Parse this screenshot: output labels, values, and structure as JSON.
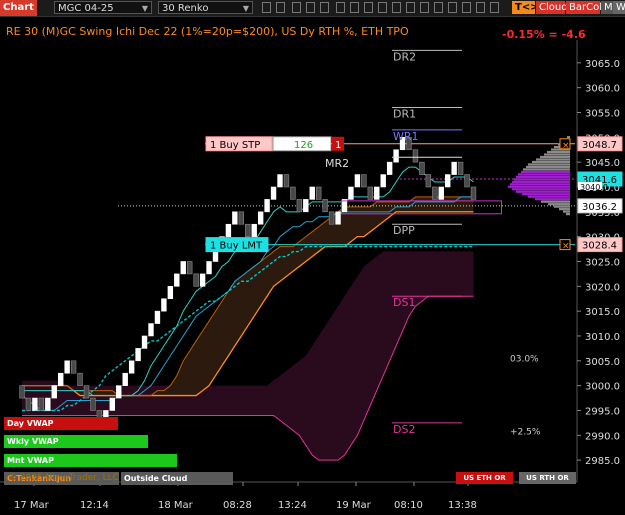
{
  "toolbar": {
    "chart_tab": "Chart",
    "instrument": "MGC 04-25",
    "period_type": "30 Renko",
    "tk_button": "T<>K",
    "cloud_button": "Cloud",
    "barcol_button": "BarCol",
    "m_button": "M",
    "w_button": "W"
  },
  "header": {
    "title": "RE 30 (M)GC Swing Ichi Dec 22 (1%=20p=$200), US Dy RTH %, ETH TPO",
    "change": "-0.15% = -4.6",
    "watermark": "© 2025 NinjaTrader, LLC"
  },
  "colors": {
    "background": "#000000",
    "up_brick": "#ffffff",
    "down_brick": "#000000",
    "axis_text": "#dddddd",
    "accent_orange": "#ff8c1a",
    "cloud_bull": "#2b1a0d",
    "cloud_bear": "#2a0b1e",
    "vwap": "#00c8c8",
    "tpo": "#a020d0"
  },
  "orders": {
    "buy_stop_label": "1 Buy STP",
    "buy_stop_ticks": "126",
    "buy_stop_qty": "1",
    "buy_limit_label": "1 Buy LMT"
  },
  "chart_data": {
    "type": "renko",
    "brick_size": 2.5,
    "y_axis": {
      "min": 2981,
      "max": 3070,
      "ticks": [
        2985.0,
        2990.0,
        2995.0,
        3000.0,
        3005.0,
        3010.0,
        3015.0,
        3020.0,
        3025.0,
        3030.0,
        3035.0,
        3040.0,
        3045.0,
        3050.0,
        3055.0,
        3060.0,
        3065.0
      ]
    },
    "x_axis": {
      "labels": [
        "17 Mar",
        "12:14",
        "18 Mar",
        "08:28",
        "13:24",
        "19 Mar",
        "08:10",
        "13:38"
      ]
    },
    "price_flags": [
      {
        "value": "3048.7",
        "kind": "buy_stop"
      },
      {
        "value": "3041.6",
        "kind": "vwap"
      },
      {
        "value": "3040.0",
        "kind": "last"
      },
      {
        "value": "3036.2",
        "kind": "close"
      },
      {
        "value": "3028.4",
        "kind": "buy_limit"
      }
    ],
    "levels": [
      {
        "name": "DR2",
        "price": 3067.5
      },
      {
        "name": "DR1",
        "price": 3056.0
      },
      {
        "name": "WR1",
        "price": 3051.5
      },
      {
        "name": "MR2",
        "price": 3046.0
      },
      {
        "name": "DPP",
        "price": 3032.5
      },
      {
        "name": "DS1",
        "price": 3018.0
      },
      {
        "name": "DS2",
        "price": 2992.5
      }
    ],
    "annotations": [
      "03.0%",
      "+2.5%"
    ],
    "vwap_legend": [
      "Day VWAP",
      "Wkly VWAP",
      "Mnt VWAP",
      "C:TenkanKijun",
      "Outside Cloud"
    ],
    "footer_tags": [
      "US ETH OR",
      "US RTH OR"
    ],
    "bricks": [
      {
        "o": 3000.0,
        "c": 2997.5
      },
      {
        "o": 2997.5,
        "c": 2995.0
      },
      {
        "o": 2995.0,
        "c": 2997.5
      },
      {
        "o": 2997.5,
        "c": 2995.0
      },
      {
        "o": 2995.0,
        "c": 2997.5
      },
      {
        "o": 2997.5,
        "c": 3000.0
      },
      {
        "o": 3000.0,
        "c": 3002.5
      },
      {
        "o": 3002.5,
        "c": 3005.0
      },
      {
        "o": 3005.0,
        "c": 3002.5
      },
      {
        "o": 3002.5,
        "c": 3000.0
      },
      {
        "o": 3000.0,
        "c": 2997.5
      },
      {
        "o": 2997.5,
        "c": 2995.0
      },
      {
        "o": 2995.0,
        "c": 2992.5
      },
      {
        "o": 2992.5,
        "c": 2995.0
      },
      {
        "o": 2995.0,
        "c": 2997.5
      },
      {
        "o": 2997.5,
        "c": 3000.0
      },
      {
        "o": 3000.0,
        "c": 3002.5
      },
      {
        "o": 3002.5,
        "c": 3005.0
      },
      {
        "o": 3005.0,
        "c": 3007.5
      },
      {
        "o": 3007.5,
        "c": 3010.0
      },
      {
        "o": 3010.0,
        "c": 3012.5
      },
      {
        "o": 3012.5,
        "c": 3015.0
      },
      {
        "o": 3015.0,
        "c": 3017.5
      },
      {
        "o": 3017.5,
        "c": 3020.0
      },
      {
        "o": 3020.0,
        "c": 3022.5
      },
      {
        "o": 3022.5,
        "c": 3025.0
      },
      {
        "o": 3025.0,
        "c": 3022.5
      },
      {
        "o": 3022.5,
        "c": 3020.0
      },
      {
        "o": 3020.0,
        "c": 3022.5
      },
      {
        "o": 3022.5,
        "c": 3025.0
      },
      {
        "o": 3025.0,
        "c": 3027.5
      },
      {
        "o": 3027.5,
        "c": 3030.0
      },
      {
        "o": 3030.0,
        "c": 3032.5
      },
      {
        "o": 3032.5,
        "c": 3035.0
      },
      {
        "o": 3035.0,
        "c": 3032.5
      },
      {
        "o": 3032.5,
        "c": 3030.0
      },
      {
        "o": 3030.0,
        "c": 3032.5
      },
      {
        "o": 3032.5,
        "c": 3035.0
      },
      {
        "o": 3035.0,
        "c": 3037.5
      },
      {
        "o": 3037.5,
        "c": 3040.0
      },
      {
        "o": 3040.0,
        "c": 3042.5
      },
      {
        "o": 3042.5,
        "c": 3040.0
      },
      {
        "o": 3040.0,
        "c": 3037.5
      },
      {
        "o": 3037.5,
        "c": 3035.0
      },
      {
        "o": 3035.0,
        "c": 3037.5
      },
      {
        "o": 3037.5,
        "c": 3040.0
      },
      {
        "o": 3040.0,
        "c": 3037.5
      },
      {
        "o": 3037.5,
        "c": 3035.0
      },
      {
        "o": 3035.0,
        "c": 3032.5
      },
      {
        "o": 3032.5,
        "c": 3035.0
      },
      {
        "o": 3035.0,
        "c": 3037.5
      },
      {
        "o": 3037.5,
        "c": 3040.0
      },
      {
        "o": 3040.0,
        "c": 3042.5
      },
      {
        "o": 3042.5,
        "c": 3040.0
      },
      {
        "o": 3040.0,
        "c": 3037.5
      },
      {
        "o": 3037.5,
        "c": 3040.0
      },
      {
        "o": 3040.0,
        "c": 3042.5
      },
      {
        "o": 3042.5,
        "c": 3045.0
      },
      {
        "o": 3045.0,
        "c": 3047.5
      },
      {
        "o": 3047.5,
        "c": 3050.0
      },
      {
        "o": 3050.0,
        "c": 3047.5
      },
      {
        "o": 3047.5,
        "c": 3045.0
      },
      {
        "o": 3045.0,
        "c": 3042.5
      },
      {
        "o": 3042.5,
        "c": 3040.0
      },
      {
        "o": 3040.0,
        "c": 3037.5
      },
      {
        "o": 3037.5,
        "c": 3040.0
      },
      {
        "o": 3040.0,
        "c": 3042.5
      },
      {
        "o": 3042.5,
        "c": 3045.0
      },
      {
        "o": 3045.0,
        "c": 3042.5
      },
      {
        "o": 3042.5,
        "c": 3040.0
      },
      {
        "o": 3040.0,
        "c": 3037.5
      }
    ],
    "series": [
      {
        "name": "tenkan",
        "values": [
          2999,
          2999,
          2999,
          2999,
          2999,
          2999,
          2999,
          2999,
          2999,
          2999,
          2999,
          2998,
          2998,
          2998,
          2998,
          2998,
          2998,
          2998,
          2999,
          3001,
          3004,
          3006,
          3008,
          3010,
          3012,
          3015,
          3017,
          3019,
          3020,
          3021,
          3022,
          3024,
          3025,
          3027,
          3028,
          3028,
          3029,
          3031,
          3033,
          3035,
          3036,
          3035,
          3035,
          3035,
          3036,
          3037,
          3037,
          3037,
          3037,
          3037,
          3037,
          3038,
          3038,
          3038,
          3038,
          3038,
          3038,
          3039,
          3041,
          3043,
          3044,
          3044,
          3043,
          3042,
          3041,
          3041,
          3041,
          3042,
          3042,
          3042,
          3041
        ]
      },
      {
        "name": "kijun",
        "values": [
          2998,
          2997,
          2996,
          2995,
          2995,
          2995,
          2996,
          2997,
          2997,
          2997,
          2997,
          2997,
          2997,
          2997,
          2997,
          2998,
          2998,
          2998,
          2998,
          2999,
          3000,
          3002,
          3004,
          3006,
          3008,
          3010,
          3012,
          3014,
          3015,
          3016,
          3017,
          3018,
          3019,
          3021,
          3022,
          3023,
          3024,
          3025,
          3027,
          3028,
          3030,
          3031,
          3032,
          3032,
          3033,
          3033,
          3034,
          3034,
          3034,
          3035,
          3035,
          3035,
          3035,
          3035,
          3035,
          3035,
          3035,
          3035,
          3036,
          3036,
          3036,
          3037,
          3037,
          3037,
          3037,
          3037,
          3037,
          3037,
          3038,
          3038,
          3038
        ]
      },
      {
        "name": "span_a",
        "values": [
          3000,
          3000,
          3000,
          3000,
          3000,
          3000,
          3000,
          3000,
          2999,
          2999,
          2999,
          2999,
          2999,
          2999,
          2999,
          2998,
          2998,
          2998,
          2998,
          2998,
          2998,
          2999,
          2999,
          3000,
          3002,
          3005,
          3007,
          3009,
          3011,
          3013,
          3015,
          3017,
          3019,
          3021,
          3022,
          3023,
          3024,
          3025,
          3026,
          3027,
          3028,
          3028,
          3028,
          3029,
          3030,
          3031,
          3032,
          3033,
          3034,
          3035,
          3036,
          3036,
          3036,
          3036,
          3036,
          3037,
          3037,
          3037,
          3037,
          3037,
          3037,
          3038,
          3038,
          3038,
          3038,
          3038,
          3038,
          3038,
          3038,
          3038,
          3038
        ]
      },
      {
        "name": "span_b",
        "values": [
          3000,
          3000,
          3000,
          3000,
          3000,
          3000,
          3000,
          3000,
          2999,
          2998,
          2998,
          2998,
          2998,
          2998,
          2998,
          2998,
          2998,
          2998,
          2998,
          2998,
          2998,
          2998,
          2998,
          2998,
          2998,
          2998,
          2998,
          2998,
          2999,
          3000,
          3002,
          3004,
          3006,
          3008,
          3010,
          3012,
          3014,
          3016,
          3018,
          3020,
          3021,
          3022,
          3023,
          3024,
          3025,
          3026,
          3027,
          3028,
          3028,
          3028,
          3028,
          3029,
          3030,
          3030,
          3031,
          3032,
          3033,
          3034,
          3035,
          3035,
          3035,
          3035,
          3035,
          3035,
          3035,
          3035,
          3035,
          3035,
          3035,
          3035,
          3035
        ]
      },
      {
        "name": "vwap_dotted",
        "values": [
          2995,
          2995,
          2995,
          2995,
          2995,
          2995,
          2995,
          2996,
          2996,
          2997,
          2998,
          2999,
          3000,
          3002,
          3003,
          3004,
          3005,
          3006,
          3007,
          3008,
          3009,
          3009,
          3010,
          3011,
          3012,
          3013,
          3014,
          3015,
          3016,
          3017,
          3017,
          3018,
          3019,
          3020,
          3021,
          3021,
          3022,
          3023,
          3024,
          3025,
          3026,
          3026,
          3027,
          3027,
          3028,
          3028,
          3028,
          3028,
          3028,
          3028,
          3028,
          3028,
          3028,
          3028,
          3028,
          3028,
          3028,
          3028,
          3028,
          3028,
          3028,
          3028,
          3028,
          3028,
          3028,
          3028,
          3028,
          3028,
          3028,
          3028,
          3028
        ]
      },
      {
        "name": "bear_cloud_top",
        "values": [
          3001,
          3001,
          3001,
          3001,
          3001,
          3001,
          3001,
          3000,
          3000,
          3000,
          3000,
          3000,
          3000,
          3000,
          3000,
          3000,
          3000,
          3000,
          3000,
          3000,
          3000,
          3000,
          3000,
          3000,
          3000,
          3000,
          3000,
          3000,
          3000,
          3000,
          3000,
          3000,
          3000,
          3000,
          3000,
          3000,
          3000,
          3000,
          3000,
          3001,
          3002,
          3003,
          3004,
          3005,
          3006,
          3008,
          3010,
          3012,
          3014,
          3016,
          3018,
          3020,
          3022,
          3024,
          3025,
          3026,
          3027,
          3027,
          3027,
          3027,
          3027,
          3027,
          3027,
          3027,
          3027,
          3027,
          3027,
          3027,
          3027,
          3027,
          3027
        ]
      },
      {
        "name": "bear_cloud_bottom",
        "values": [
          2994,
          2994,
          2994,
          2994,
          2994,
          2994,
          2994,
          2994,
          2994,
          2994,
          2994,
          2994,
          2994,
          2994,
          2994,
          2994,
          2994,
          2994,
          2994,
          2994,
          2994,
          2994,
          2994,
          2994,
          2994,
          2994,
          2994,
          2994,
          2994,
          2994,
          2994,
          2994,
          2994,
          2994,
          2994,
          2994,
          2994,
          2994,
          2994,
          2994,
          2993,
          2992,
          2991,
          2990,
          2988,
          2986,
          2985,
          2985,
          2985,
          2985,
          2986,
          2988,
          2990,
          2993,
          2996,
          2999,
          3002,
          3005,
          3008,
          3011,
          3014,
          3016,
          3017,
          3018,
          3018,
          3018,
          3018,
          3018,
          3018,
          3018,
          3018
        ]
      }
    ],
    "tpo_profile": [
      {
        "price": 3050.0,
        "width": 3
      },
      {
        "price": 3049.5,
        "width": 6
      },
      {
        "price": 3049.0,
        "width": 9
      },
      {
        "price": 3048.5,
        "width": 12
      },
      {
        "price": 3048.0,
        "width": 16
      },
      {
        "price": 3047.5,
        "width": 19
      },
      {
        "price": 3047.0,
        "width": 23
      },
      {
        "price": 3046.5,
        "width": 26
      },
      {
        "price": 3046.0,
        "width": 30
      },
      {
        "price": 3045.5,
        "width": 34
      },
      {
        "price": 3045.0,
        "width": 38
      },
      {
        "price": 3044.5,
        "width": 42
      },
      {
        "price": 3044.0,
        "width": 44
      },
      {
        "price": 3043.5,
        "width": 47
      },
      {
        "price": 3043.0,
        "width": 49
      },
      {
        "price": 3042.5,
        "width": 52
      },
      {
        "price": 3042.0,
        "width": 54
      },
      {
        "price": 3041.5,
        "width": 56
      },
      {
        "price": 3041.0,
        "width": 58
      },
      {
        "price": 3040.5,
        "width": 60
      },
      {
        "price": 3040.0,
        "width": 62
      },
      {
        "price": 3039.5,
        "width": 58
      },
      {
        "price": 3039.0,
        "width": 54
      },
      {
        "price": 3038.5,
        "width": 48
      },
      {
        "price": 3038.0,
        "width": 42
      },
      {
        "price": 3037.5,
        "width": 35
      },
      {
        "price": 3037.0,
        "width": 29
      },
      {
        "price": 3036.5,
        "width": 22
      },
      {
        "price": 3036.0,
        "width": 16
      },
      {
        "price": 3035.5,
        "width": 11
      },
      {
        "price": 3035.0,
        "width": 7
      },
      {
        "price": 3034.5,
        "width": 4
      }
    ]
  }
}
